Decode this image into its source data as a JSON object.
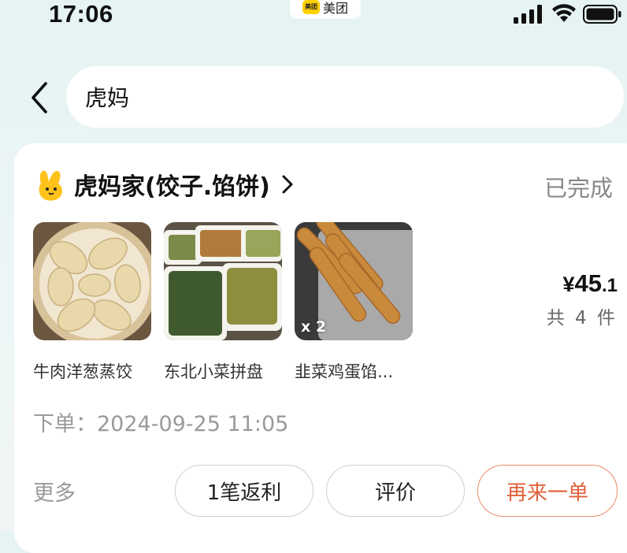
{
  "status_bar": {
    "time": "17:06",
    "app_logo_text": "美团",
    "app_name": "美团"
  },
  "nav": {
    "search_value": "虎妈"
  },
  "order": {
    "shop_name": "虎妈家(饺子.馅饼)",
    "status": "已完成",
    "items": [
      {
        "name": "牛肉洋葱蒸饺",
        "qty": ""
      },
      {
        "name": "东北小菜拼盘",
        "qty": ""
      },
      {
        "name": "韭菜鸡蛋馅...",
        "qty": "x 2"
      }
    ],
    "price_symbol": "¥",
    "price_int": "45",
    "price_dec": ".1",
    "item_count": "共 4 件",
    "order_time": "下单：2024-09-25 11:05",
    "more_label": "更多",
    "buttons": {
      "rebate": "1笔返利",
      "review": "评价",
      "reorder": "再来一单"
    }
  },
  "colors": {
    "background": "#e9f4f4",
    "accent_reorder": "#e2603a",
    "brand_yellow": "#ffd100"
  }
}
